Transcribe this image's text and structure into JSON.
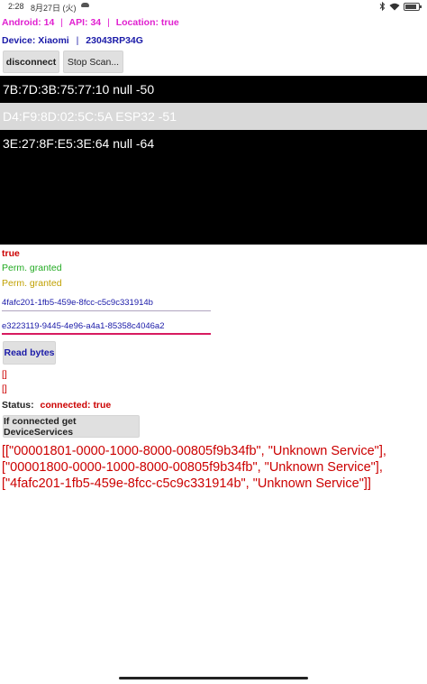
{
  "status_bar": {
    "time": "2:28",
    "date": "8月27日 (火)",
    "battery_percent": 85
  },
  "info": {
    "android_label": "Android:",
    "android_value": "14",
    "api_label": "API:",
    "api_value": "34",
    "location_label": "Location:",
    "location_value": "true"
  },
  "device": {
    "label": "Device:",
    "manufacturer": "Xiaomi",
    "model": "23043RP34G"
  },
  "buttons": {
    "disconnect": "disconnect",
    "stop_scan": "Stop Scan...",
    "read_bytes": "Read bytes",
    "get_services": "If connected get DeviceServices"
  },
  "devices": [
    {
      "text": "7B:7D:3B:75:77:10 null -50",
      "selected": false
    },
    {
      "text": "D4:F9:8D:02:5C:5A ESP32 -51",
      "selected": true
    },
    {
      "text": "3E:27:8F:E5:3E:64 null -64",
      "selected": false
    }
  ],
  "flag": "true",
  "permissions": [
    "Perm. granted",
    "Perm. granted"
  ],
  "service_uuid": "4fafc201-1fb5-459e-8fcc-c5c9c331914b",
  "characteristic_uuid": "e3223119-9445-4e96-a4a1-85358c4046a2",
  "brackets": [
    "[]",
    "[]"
  ],
  "status": {
    "label": "Status:",
    "value": "connected: true"
  },
  "services_output": [
    "[[\"00001801-0000-1000-8000-00805f9b34fb\", \"Unknown Service\"],",
    "[\"00001800-0000-1000-8000-00805f9b34fb\", \"Unknown Service\"],",
    "[\"4fafc201-1fb5-459e-8fcc-c5c9c331914b\", \"Unknown Service\"]]"
  ],
  "colors": {
    "accent_magenta": "#e020d0",
    "device_blue": "#1a1aa8",
    "error_red": "#cc0000",
    "list_bg": "#000000",
    "selected_row": "#d9d9d9"
  }
}
